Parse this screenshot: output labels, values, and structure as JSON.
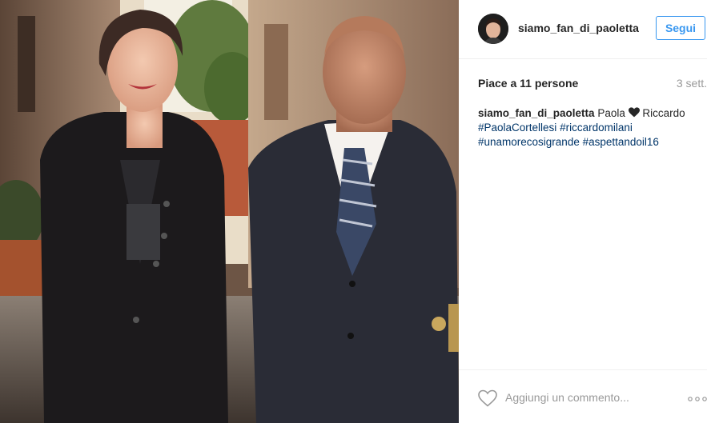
{
  "post": {
    "username": "siamo_fan_di_paoletta",
    "follow_label": "Segui",
    "likes_text": "Piace a 11 persone",
    "time_text": "3 sett.",
    "caption": {
      "user": "siamo_fan_di_paoletta",
      "text_before": "Paola",
      "text_after": "Riccardo",
      "hashtags": [
        "#PaolaCortellesi",
        "#riccardomilani",
        "#unamorecosigrande",
        "#aspettandoil16"
      ]
    },
    "comment_placeholder": "Aggiungi un commento...",
    "icons": {
      "heart_caption": "heart-icon",
      "like": "heart-outline-icon",
      "more": "ellipsis-icon"
    }
  },
  "colors": {
    "accent": "#3897f0",
    "hashtag": "#003569",
    "muted": "#999999",
    "text": "#262626"
  }
}
